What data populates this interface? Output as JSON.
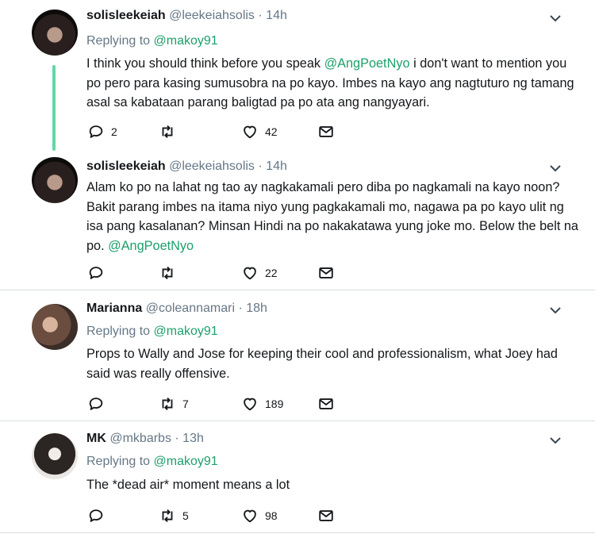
{
  "tweets": [
    {
      "name": "solisleekeiah",
      "handle": "@leekeiahsolis",
      "time": "· 14h",
      "reply_prefix": "Replying to",
      "reply_to": "@makoy91",
      "body_parts": [
        "I think you should think before you speak ",
        "@AngPoetNyo",
        " i don't want to mention you po pero para kasing sumusobra na po kayo. Imbes na kayo ang nagtuturo ng tamang asal sa kabataan parang baligtad pa po ata ang nangyayari."
      ],
      "reply_count": "2",
      "retweet_count": "",
      "like_count": "42",
      "avatar_icon": "avatar-photo"
    },
    {
      "name": "solisleekeiah",
      "handle": "@leekeiahsolis",
      "time": "· 14h",
      "body_parts": [
        "Alam ko po na lahat ng tao ay nagkakamali pero diba po nagkamali na kayo noon? Bakit parang imbes na itama niyo yung pagkakamali mo, nagawa pa po kayo ulit ng isa pang kasalanan? Minsan  Hindi na po nakakatawa yung joke mo. Below the belt na po. ",
        "@AngPoetNyo",
        ""
      ],
      "reply_count": "",
      "retweet_count": "",
      "like_count": "22"
    },
    {
      "name": "Marianna",
      "handle": "@coleannamari",
      "time": "· 18h",
      "reply_prefix": "Replying to",
      "reply_to": "@makoy91",
      "body_parts": [
        "Props to Wally and Jose for keeping their cool and professionalism, what Joey had said was really offensive.",
        "",
        ""
      ],
      "reply_count": "",
      "retweet_count": "7",
      "like_count": "189"
    },
    {
      "name": "MK",
      "handle": "@mkbarbs",
      "time": "· 13h",
      "reply_prefix": "Replying to",
      "reply_to": "@makoy91",
      "body_parts": [
        "The *dead air* moment means a lot",
        "",
        ""
      ],
      "reply_count": "",
      "retweet_count": "5",
      "like_count": "98"
    }
  ],
  "colors": {
    "mention": "#1da06b",
    "thread_line": "#63d6a7",
    "muted": "#657786"
  }
}
